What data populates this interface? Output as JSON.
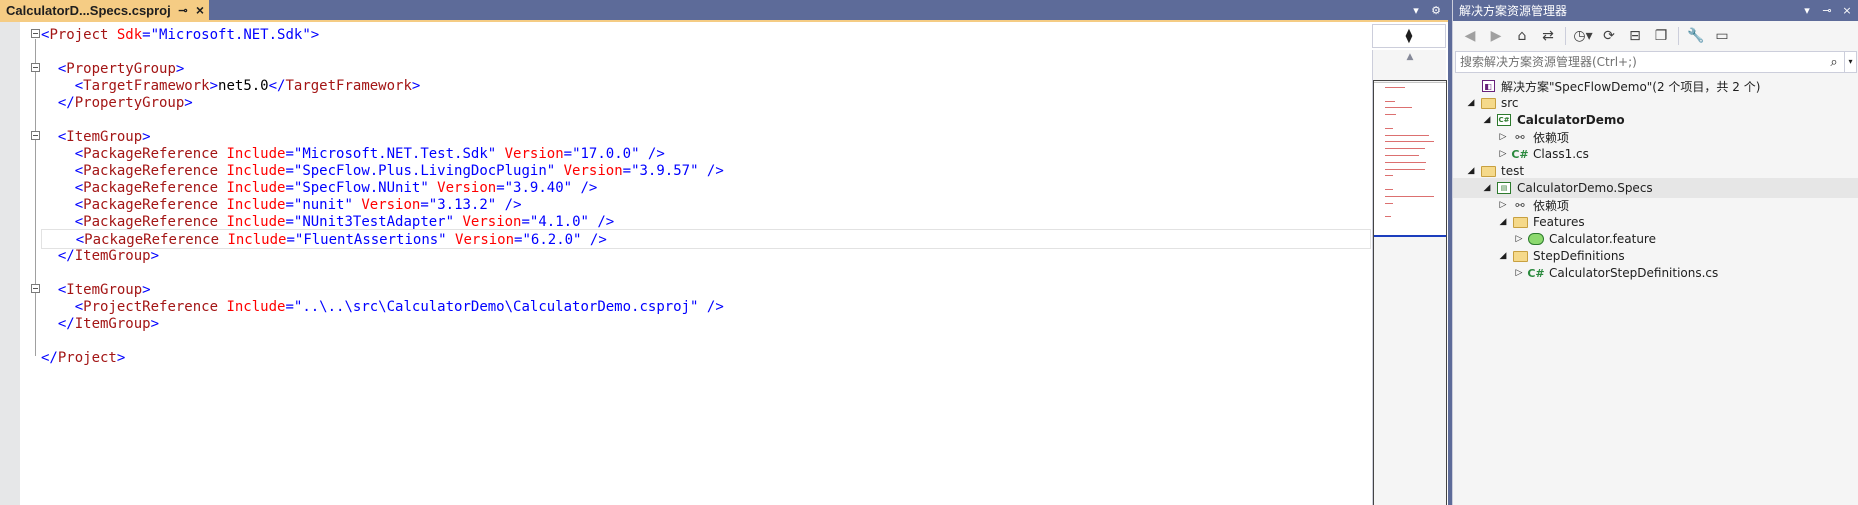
{
  "editor": {
    "tab": {
      "title": "CalculatorD...Specs.csproj",
      "pin_icon": "pin-icon",
      "close_icon": "close-icon"
    },
    "tab_strip_icons": [
      "dropdown-icon",
      "gear-icon"
    ],
    "lines": [
      {
        "parts": [
          [
            "br",
            "<"
          ],
          [
            "el",
            "Project"
          ],
          [
            "at",
            " Sdk"
          ],
          [
            "eq",
            "="
          ],
          [
            "va",
            "\"Microsoft.NET.Sdk\""
          ],
          [
            "br",
            ">"
          ]
        ]
      },
      {
        "parts": []
      },
      {
        "parts": [
          [
            "tx",
            "  "
          ],
          [
            "br",
            "<"
          ],
          [
            "el",
            "PropertyGroup"
          ],
          [
            "br",
            ">"
          ]
        ]
      },
      {
        "parts": [
          [
            "tx",
            "    "
          ],
          [
            "br",
            "<"
          ],
          [
            "el",
            "TargetFramework"
          ],
          [
            "br",
            ">"
          ],
          [
            "tx",
            "net5.0"
          ],
          [
            "br",
            "</"
          ],
          [
            "el",
            "TargetFramework"
          ],
          [
            "br",
            ">"
          ]
        ]
      },
      {
        "parts": [
          [
            "tx",
            "  "
          ],
          [
            "br",
            "</"
          ],
          [
            "el",
            "PropertyGroup"
          ],
          [
            "br",
            ">"
          ]
        ]
      },
      {
        "parts": []
      },
      {
        "parts": [
          [
            "tx",
            "  "
          ],
          [
            "br",
            "<"
          ],
          [
            "el",
            "ItemGroup"
          ],
          [
            "br",
            ">"
          ]
        ]
      },
      {
        "parts": [
          [
            "tx",
            "    "
          ],
          [
            "br",
            "<"
          ],
          [
            "el",
            "PackageReference"
          ],
          [
            "at",
            " Include"
          ],
          [
            "eq",
            "="
          ],
          [
            "va",
            "\"Microsoft.NET.Test.Sdk\""
          ],
          [
            "at",
            " Version"
          ],
          [
            "eq",
            "="
          ],
          [
            "va",
            "\"17.0.0\""
          ],
          [
            "br",
            " />"
          ]
        ]
      },
      {
        "parts": [
          [
            "tx",
            "    "
          ],
          [
            "br",
            "<"
          ],
          [
            "el",
            "PackageReference"
          ],
          [
            "at",
            " Include"
          ],
          [
            "eq",
            "="
          ],
          [
            "va",
            "\"SpecFlow.Plus.LivingDocPlugin\""
          ],
          [
            "at",
            " Version"
          ],
          [
            "eq",
            "="
          ],
          [
            "va",
            "\"3.9.57\""
          ],
          [
            "br",
            " />"
          ]
        ]
      },
      {
        "parts": [
          [
            "tx",
            "    "
          ],
          [
            "br",
            "<"
          ],
          [
            "el",
            "PackageReference"
          ],
          [
            "at",
            " Include"
          ],
          [
            "eq",
            "="
          ],
          [
            "va",
            "\"SpecFlow.NUnit\""
          ],
          [
            "at",
            " Version"
          ],
          [
            "eq",
            "="
          ],
          [
            "va",
            "\"3.9.40\""
          ],
          [
            "br",
            " />"
          ]
        ]
      },
      {
        "parts": [
          [
            "tx",
            "    "
          ],
          [
            "br",
            "<"
          ],
          [
            "el",
            "PackageReference"
          ],
          [
            "at",
            " Include"
          ],
          [
            "eq",
            "="
          ],
          [
            "va",
            "\"nunit\""
          ],
          [
            "at",
            " Version"
          ],
          [
            "eq",
            "="
          ],
          [
            "va",
            "\"3.13.2\""
          ],
          [
            "br",
            " />"
          ]
        ]
      },
      {
        "parts": [
          [
            "tx",
            "    "
          ],
          [
            "br",
            "<"
          ],
          [
            "el",
            "PackageReference"
          ],
          [
            "at",
            " Include"
          ],
          [
            "eq",
            "="
          ],
          [
            "va",
            "\"NUnit3TestAdapter\""
          ],
          [
            "at",
            " Version"
          ],
          [
            "eq",
            "="
          ],
          [
            "va",
            "\"4.1.0\""
          ],
          [
            "br",
            " />"
          ]
        ]
      },
      {
        "parts": [
          [
            "tx",
            "    "
          ],
          [
            "br",
            "<"
          ],
          [
            "el",
            "PackageReference"
          ],
          [
            "at",
            " Include"
          ],
          [
            "eq",
            "="
          ],
          [
            "va",
            "\"FluentAssertions\""
          ],
          [
            "at",
            " Version"
          ],
          [
            "eq",
            "="
          ],
          [
            "va",
            "\"6.2.0\""
          ],
          [
            "br",
            " />"
          ]
        ],
        "current": true
      },
      {
        "parts": [
          [
            "tx",
            "  "
          ],
          [
            "br",
            "</"
          ],
          [
            "el",
            "ItemGroup"
          ],
          [
            "br",
            ">"
          ]
        ]
      },
      {
        "parts": []
      },
      {
        "parts": [
          [
            "tx",
            "  "
          ],
          [
            "br",
            "<"
          ],
          [
            "el",
            "ItemGroup"
          ],
          [
            "br",
            ">"
          ]
        ]
      },
      {
        "parts": [
          [
            "tx",
            "    "
          ],
          [
            "br",
            "<"
          ],
          [
            "el",
            "ProjectReference"
          ],
          [
            "at",
            " Include"
          ],
          [
            "eq",
            "="
          ],
          [
            "va",
            "\"..\\..\\src\\CalculatorDemo\\CalculatorDemo.csproj\""
          ],
          [
            "br",
            " />"
          ]
        ]
      },
      {
        "parts": [
          [
            "tx",
            "  "
          ],
          [
            "br",
            "</"
          ],
          [
            "el",
            "ItemGroup"
          ],
          [
            "br",
            ">"
          ]
        ]
      },
      {
        "parts": []
      },
      {
        "parts": [
          [
            "br",
            "</"
          ],
          [
            "el",
            "Project"
          ],
          [
            "br",
            ">"
          ]
        ]
      }
    ],
    "minimap": {
      "split_icon": "split-icon",
      "up_icon": "scroll-up-icon"
    }
  },
  "solution_explorer": {
    "title": "解决方案资源管理器",
    "title_buttons": [
      "dropdown-icon",
      "pin-icon",
      "close-icon"
    ],
    "toolbar": [
      "back-icon",
      "forward-icon",
      "home-icon",
      "switch-views-icon",
      "pending-changes-filter-icon",
      "sync-icon",
      "collapse-all-icon",
      "show-all-files-icon",
      "properties-icon",
      "preview-icon"
    ],
    "search": {
      "placeholder": "搜索解决方案资源管理器(Ctrl+;)",
      "value": ""
    },
    "tree": [
      {
        "label": "解决方案\"SpecFlowDemo\"(2 个项目，共 2 个)",
        "depth": 0,
        "icon": "solution-icon",
        "expand": "none"
      },
      {
        "label": "src",
        "depth": 0,
        "icon": "folder-icon",
        "expand": "expanded"
      },
      {
        "label": "CalculatorDemo",
        "depth": 1,
        "icon": "csharp-project-icon",
        "expand": "expanded",
        "bold": true
      },
      {
        "label": "依赖项",
        "depth": 2,
        "icon": "dependencies-icon",
        "expand": "collapsed"
      },
      {
        "label": "Class1.cs",
        "depth": 2,
        "icon": "csharp-file-icon",
        "expand": "collapsed"
      },
      {
        "label": "test",
        "depth": 0,
        "icon": "folder-icon",
        "expand": "expanded"
      },
      {
        "label": "CalculatorDemo.Specs",
        "depth": 1,
        "icon": "test-project-icon",
        "expand": "expanded",
        "selected": true
      },
      {
        "label": "依赖项",
        "depth": 2,
        "icon": "dependencies-icon",
        "expand": "collapsed"
      },
      {
        "label": "Features",
        "depth": 2,
        "icon": "folder-icon",
        "expand": "expanded"
      },
      {
        "label": "Calculator.feature",
        "depth": 3,
        "icon": "feature-file-icon",
        "expand": "collapsed"
      },
      {
        "label": "StepDefinitions",
        "depth": 2,
        "icon": "folder-icon",
        "expand": "expanded"
      },
      {
        "label": "CalculatorStepDefinitions.cs",
        "depth": 3,
        "icon": "csharp-file-icon",
        "expand": "collapsed"
      }
    ]
  }
}
